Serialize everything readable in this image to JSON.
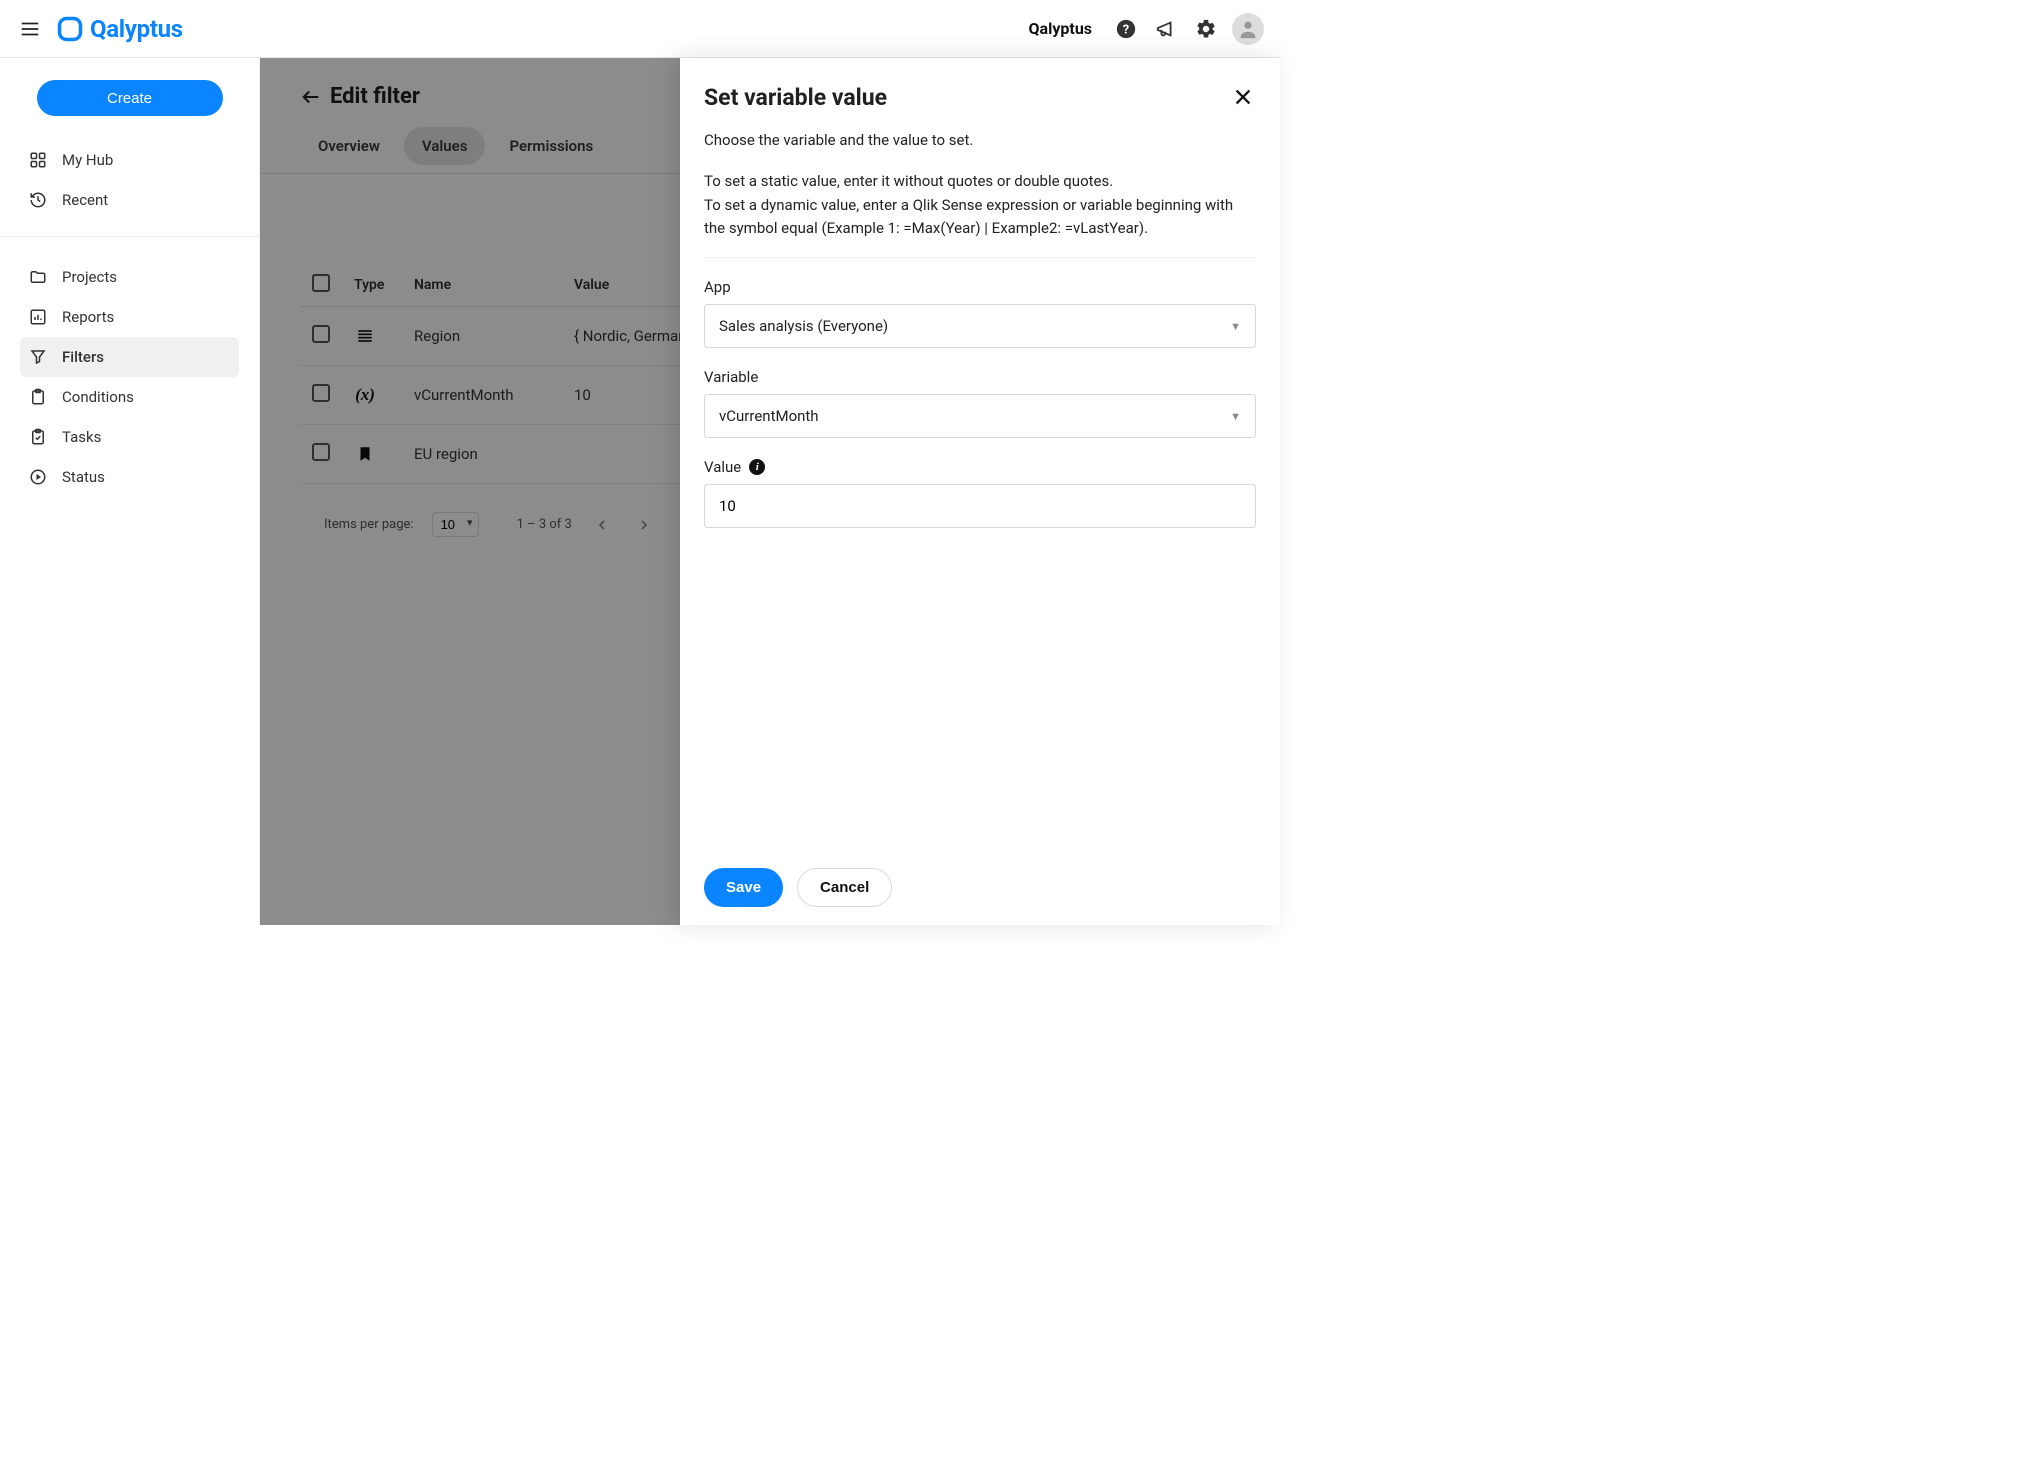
{
  "brand": {
    "name": "Qalyptus"
  },
  "topbar": {
    "org_name": "Qalyptus"
  },
  "sidebar": {
    "create_label": "Create",
    "items_top": [
      {
        "label": "My Hub",
        "icon": "hub"
      },
      {
        "label": "Recent",
        "icon": "recent"
      }
    ],
    "items_main": [
      {
        "label": "Projects",
        "icon": "folder"
      },
      {
        "label": "Reports",
        "icon": "chart"
      },
      {
        "label": "Filters",
        "icon": "filter",
        "active": true
      },
      {
        "label": "Conditions",
        "icon": "clipboard"
      },
      {
        "label": "Tasks",
        "icon": "task"
      },
      {
        "label": "Status",
        "icon": "status"
      }
    ]
  },
  "page": {
    "title": "Edit filter",
    "tabs": [
      {
        "label": "Overview"
      },
      {
        "label": "Values",
        "active": true
      },
      {
        "label": "Permissions"
      }
    ]
  },
  "table": {
    "columns": [
      "Type",
      "Name",
      "Value"
    ],
    "rows": [
      {
        "type_icon": "list",
        "name": "Region",
        "value": "{ Nordic, Germany, Spa"
      },
      {
        "type_icon": "variable",
        "name": "vCurrentMonth",
        "value": "10"
      },
      {
        "type_icon": "bookmark",
        "name": "EU region",
        "value": ""
      }
    ]
  },
  "pager": {
    "items_label": "Items per page:",
    "page_size": "10",
    "range": "1 – 3 of 3"
  },
  "panel": {
    "title": "Set variable value",
    "desc1": "Choose the variable and the value to set.",
    "desc2": "To set a static value, enter it without quotes or double quotes.",
    "desc3": "To set a dynamic value, enter a Qlik Sense expression or variable beginning with the symbol equal (Example 1: =Max(Year) | Example2: =vLastYear).",
    "app_label": "App",
    "app_value": "Sales analysis (Everyone)",
    "variable_label": "Variable",
    "variable_value": "vCurrentMonth",
    "value_label": "Value",
    "value_value": "10",
    "save_label": "Save",
    "cancel_label": "Cancel"
  }
}
